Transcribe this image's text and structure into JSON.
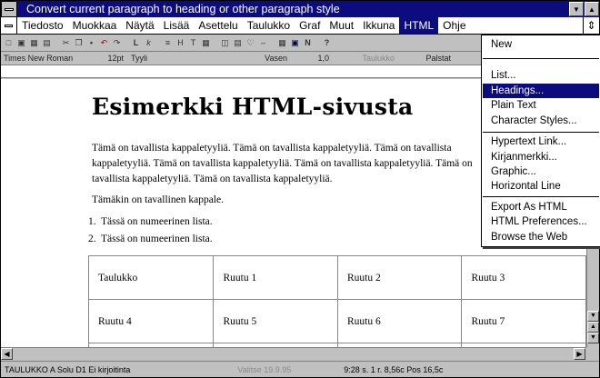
{
  "title": "Convert current paragraph to heading or other paragraph style",
  "menu": [
    "Tiedosto",
    "Muokkaa",
    "Näytä",
    "Lisää",
    "Asettelu",
    "Taulukko",
    "Graf",
    "Muut",
    "Ikkuna",
    "HTML",
    "Ohje"
  ],
  "format": {
    "font": "Times New Roman",
    "size": "12pt",
    "style": "Tyyli",
    "align": "Vasen",
    "spacing": "1,0",
    "table_cmd": "Taulukko",
    "columns": "Palstat"
  },
  "document": {
    "heading": "Esimerkki HTML-sivusta",
    "para1": "Tämä on tavallista kappaletyyliä. Tämä on tavallista kappaletyyliä. Tämä on tavallista kappaletyyliä. Tämä on tavallista kappaletyyliä. Tämä on tavallista kappaletyyliä. Tämä on tavallista kappaletyyliä. Tämä on tavallista kappaletyyliä.",
    "para2": "Tämäkin on tavallinen kappale.",
    "list": [
      {
        "num": "1.",
        "text": "Tässä on numeerinen lista."
      },
      {
        "num": "2.",
        "text": "Tässä on numeerinen lista."
      }
    ],
    "table": [
      [
        "Taulukko",
        "Ruutu 1",
        "Ruutu 2",
        "Ruutu 3"
      ],
      [
        "Ruutu 4",
        "Ruutu 5",
        "Ruutu 6",
        "Ruutu 7"
      ],
      [
        "",
        "",
        "",
        ""
      ]
    ]
  },
  "html_menu": {
    "items": [
      "New",
      "List...",
      "Headings...",
      "Plain Text",
      "Character Styles...",
      "Hypertext Link...",
      "Kirjanmerkki...",
      "Graphic...",
      "Horizontal Line",
      "Export As HTML",
      "HTML Preferences...",
      "Browse the Web"
    ],
    "highlighted": "Headings..."
  },
  "status": {
    "cell": "TAULUKKO A Solu D1 Ei kirjoitinta",
    "date": "Valitse 19.9.95",
    "pos": "9:28  s. 1 r. 8,56c Pos 16,5c"
  },
  "colors": {
    "titlebar": "#0c0c7e",
    "highlight": "#0c0c7e"
  }
}
